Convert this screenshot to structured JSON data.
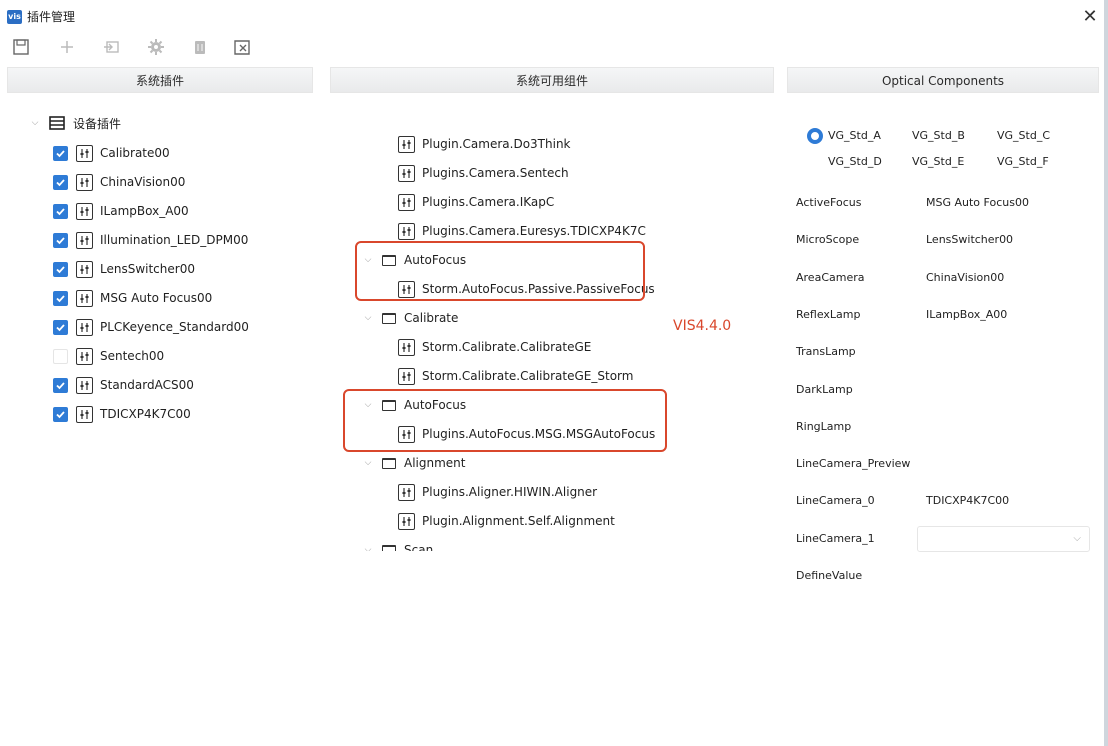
{
  "window": {
    "title": "插件管理",
    "app_icon_text": "vis"
  },
  "toolbar": {
    "icons": [
      "save-icon",
      "add-icon",
      "import-icon",
      "settings-icon",
      "delete-icon",
      "close-all-icon"
    ]
  },
  "panes": {
    "left_title": "系统插件",
    "middle_title": "系统可用组件",
    "right_title": "Optical Components"
  },
  "left_tree": {
    "root_label": "设备插件",
    "items": [
      {
        "label": "Calibrate00",
        "checked": true
      },
      {
        "label": "ChinaVision00",
        "checked": true
      },
      {
        "label": "ILampBox_A00",
        "checked": true
      },
      {
        "label": "Illumination_LED_DPM00",
        "checked": true
      },
      {
        "label": "LensSwitcher00",
        "checked": true
      },
      {
        "label": "MSG Auto Focus00",
        "checked": true
      },
      {
        "label": "PLCKeyence_Standard00",
        "checked": true
      },
      {
        "label": "Sentech00",
        "checked": false
      },
      {
        "label": "StandardACS00",
        "checked": true
      },
      {
        "label": "TDICXP4K7C00",
        "checked": true
      }
    ]
  },
  "middle_tree": {
    "camera_items": [
      "Plugin.Camera.Do3Think",
      "Plugins.Camera.Sentech",
      "Plugins.Camera.IKapC",
      "Plugins.Camera.Euresys.TDICXP4K7C"
    ],
    "group_autofocus_1": {
      "label": "AutoFocus",
      "items": [
        "Storm.AutoFocus.Passive.PassiveFocus"
      ]
    },
    "group_calibrate": {
      "label": "Calibrate",
      "items": [
        "Storm.Calibrate.CalibrateGE",
        "Storm.Calibrate.CalibrateGE_Storm"
      ]
    },
    "group_autofocus_2": {
      "label": "AutoFocus",
      "items": [
        "Plugins.AutoFocus.MSG.MSGAutoFocus"
      ]
    },
    "group_alignment": {
      "label": "Alignment",
      "items": [
        "Plugins.Aligner.HIWIN.Aligner",
        "Plugin.Alignment.Self.Alignment"
      ]
    },
    "group_scan_partial": {
      "label": "Scan"
    }
  },
  "annotation": {
    "version_label": "VIS4.4.0"
  },
  "optical": {
    "radios": [
      {
        "label": "VG_Std_A",
        "selected": true
      },
      {
        "label": "VG_Std_B",
        "selected": false
      },
      {
        "label": "VG_Std_C",
        "selected": false
      },
      {
        "label": "VG_Std_D",
        "selected": false
      },
      {
        "label": "VG_Std_E",
        "selected": false
      },
      {
        "label": "VG_Std_F",
        "selected": false
      }
    ],
    "fields": [
      {
        "label": "ActiveFocus",
        "value": "MSG Auto Focus00"
      },
      {
        "label": "MicroScope",
        "value": "LensSwitcher00"
      },
      {
        "label": "AreaCamera",
        "value": "ChinaVision00"
      },
      {
        "label": "ReflexLamp",
        "value": "ILampBox_A00"
      },
      {
        "label": "TransLamp",
        "value": ""
      },
      {
        "label": "DarkLamp",
        "value": ""
      },
      {
        "label": "RingLamp",
        "value": ""
      },
      {
        "label": "LineCamera_Preview",
        "value": ""
      },
      {
        "label": "LineCamera_0",
        "value": "TDICXP4K7C00"
      },
      {
        "label": "LineCamera_1",
        "value": ""
      },
      {
        "label": "DefineValue",
        "value": ""
      }
    ]
  },
  "colors": {
    "accent": "#2e7bd6",
    "highlight": "#d9472c"
  }
}
